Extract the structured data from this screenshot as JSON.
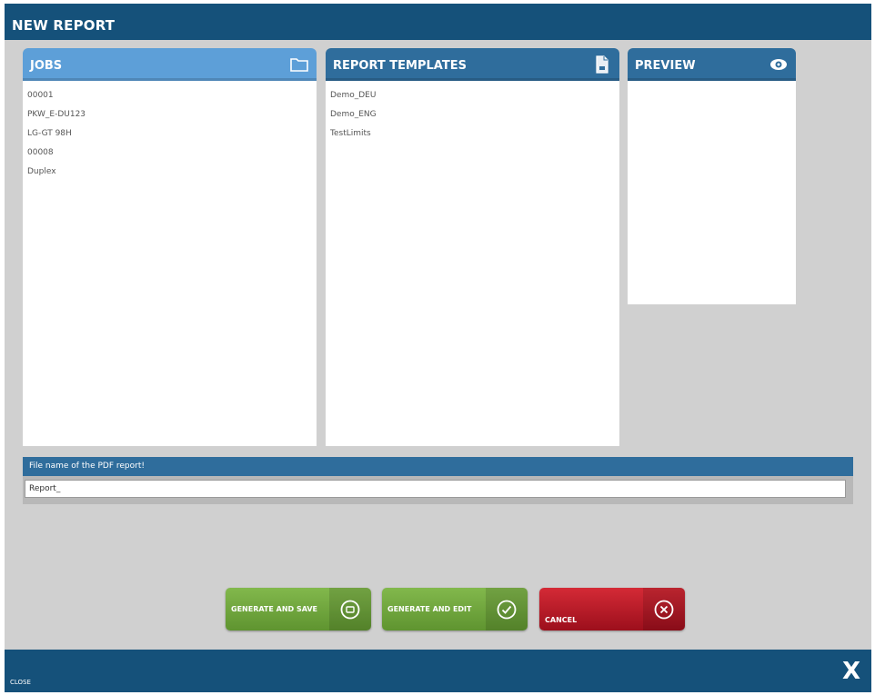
{
  "window": {
    "title": "NEW REPORT"
  },
  "panels": {
    "jobs": {
      "title": "JOBS",
      "icon": "folder-icon",
      "items": [
        "00001",
        "PKW_E-DU123",
        "LG-GT 98H",
        "00008",
        "Duplex"
      ]
    },
    "templates": {
      "title": "REPORT TEMPLATES",
      "icon": "document-icon",
      "items": [
        "Demo_DEU",
        "Demo_ENG",
        "TestLimits"
      ]
    },
    "preview": {
      "title": "PREVIEW",
      "icon": "eye-icon"
    }
  },
  "filename": {
    "label": "File name of the PDF report!",
    "value": "Report_"
  },
  "buttons": {
    "generate_save": {
      "label": "GENERATE AND SAVE",
      "icon": "save-circle-icon"
    },
    "generate_edit": {
      "label": "GENERATE AND EDIT",
      "icon": "check-circle-icon"
    },
    "cancel": {
      "label": "CANCEL",
      "icon": "cancel-circle-icon"
    }
  },
  "footer": {
    "close_label": "CLOSE",
    "close_glyph": "X"
  },
  "colors": {
    "titlebar": "#15517a",
    "jobs_header": "#5d9fd8",
    "panel_header": "#2f6d9c",
    "green_button": "#6fa63c",
    "red_button": "#c01c28"
  }
}
